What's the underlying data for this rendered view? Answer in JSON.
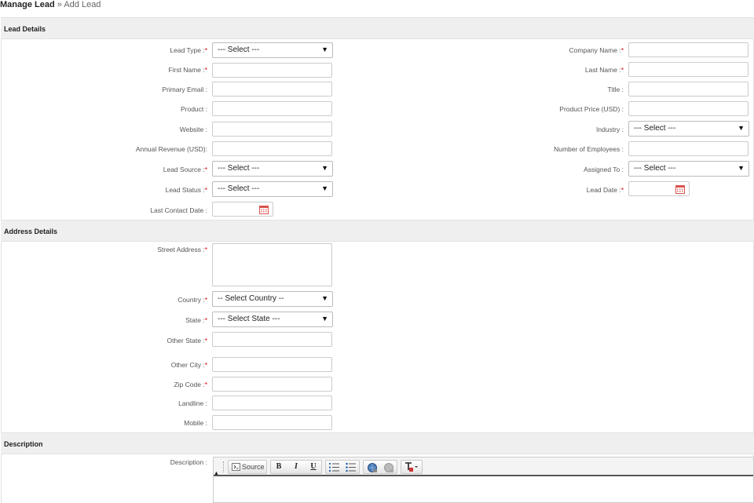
{
  "breadcrumb": {
    "parent": "Manage Lead",
    "separator": "»",
    "current": "Add Lead"
  },
  "sections": {
    "lead_details": "Lead Details",
    "address_details": "Address Details",
    "description": "Description"
  },
  "lead": {
    "lead_type": {
      "label": "Lead Type :",
      "required": "*",
      "value": "--- Select ---"
    },
    "company_name": {
      "label": "Company Name :",
      "required": "*",
      "value": ""
    },
    "first_name": {
      "label": "First Name :",
      "required": "*",
      "value": ""
    },
    "last_name": {
      "label": "Last Name :",
      "required": "*",
      "value": ""
    },
    "primary_email": {
      "label": "Primary Email :",
      "value": ""
    },
    "title": {
      "label": "Title :",
      "value": ""
    },
    "product": {
      "label": "Product :",
      "value": ""
    },
    "product_price": {
      "label": "Product Price (USD) :",
      "value": ""
    },
    "website": {
      "label": "Website :",
      "value": ""
    },
    "industry": {
      "label": "Industry :",
      "value": "--- Select ---"
    },
    "annual_revenue": {
      "label": "Annual Revenue (USD):",
      "value": ""
    },
    "num_employees": {
      "label": "Number of Employees :",
      "value": ""
    },
    "lead_source": {
      "label": "Lead Source :",
      "required": "*",
      "value": "--- Select ---"
    },
    "assigned_to": {
      "label": "Assigned To :",
      "value": "--- Select ---"
    },
    "lead_status": {
      "label": "Lead Status :",
      "required": "*",
      "value": "--- Select ---"
    },
    "lead_date": {
      "label": "Lead Date :",
      "required": "*",
      "value": ""
    },
    "last_contact_date": {
      "label": "Last Contact Date :",
      "value": ""
    }
  },
  "address": {
    "street": {
      "label": "Street Address :",
      "required": "*",
      "value": ""
    },
    "country": {
      "label": "Country :",
      "required": "*",
      "value": "-- Select Country --"
    },
    "state": {
      "label": "State :",
      "required": "*",
      "value": "--- Select State ---"
    },
    "other_state": {
      "label": "Other State :",
      "required": "*",
      "value": ""
    },
    "other_city": {
      "label": "Other City :",
      "required": "*",
      "value": ""
    },
    "zip": {
      "label": "Zip Code :",
      "required": "*",
      "value": ""
    },
    "landline": {
      "label": "Landline :",
      "value": ""
    },
    "mobile": {
      "label": "Mobile :",
      "value": ""
    }
  },
  "description": {
    "label": "Description :",
    "toolbar": {
      "source": "Source",
      "bold": "B",
      "italic": "I",
      "underline": "U"
    }
  },
  "colors": {
    "required": "#dd0000",
    "section_bg": "#efefef",
    "calendar": "#d9534f"
  }
}
